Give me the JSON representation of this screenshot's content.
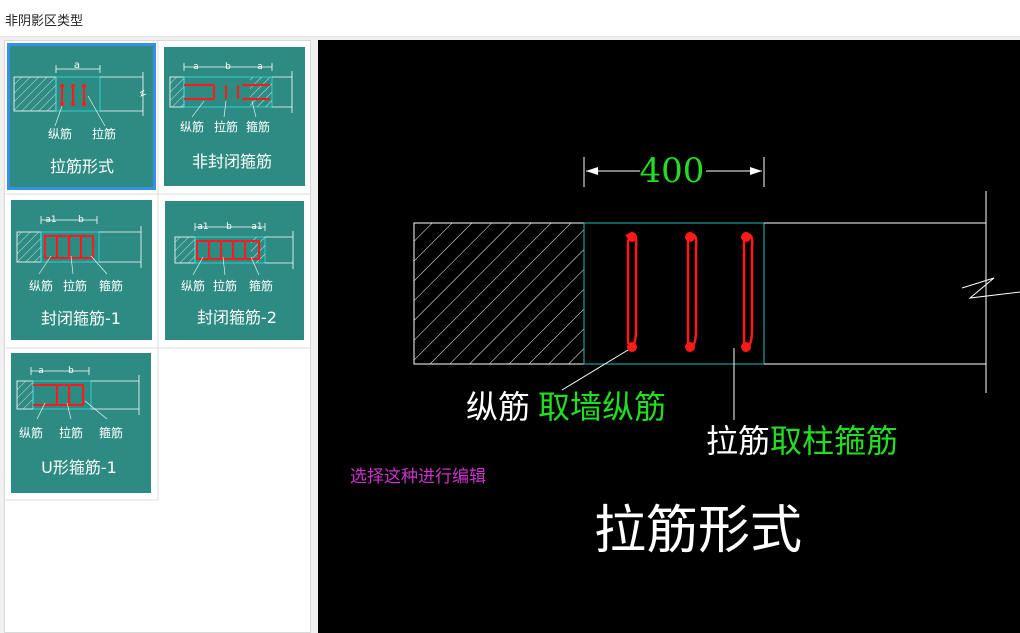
{
  "window": {
    "title": "非阴影区类型"
  },
  "thumbnails": [
    {
      "label": "拉筋形式",
      "selected": true,
      "legend": [
        "纵筋",
        "拉筋"
      ],
      "dims": [
        "a"
      ]
    },
    {
      "label": "非封闭箍筋",
      "selected": false,
      "legend": [
        "纵筋",
        "拉筋",
        "箍筋"
      ],
      "dims": [
        "a",
        "b",
        "a"
      ]
    },
    {
      "label": "封闭箍筋-1",
      "selected": false,
      "legend": [
        "纵筋",
        "拉筋",
        "箍筋"
      ],
      "dims": [
        "a1",
        "b"
      ]
    },
    {
      "label": "封闭箍筋-2",
      "selected": false,
      "legend": [
        "纵筋",
        "拉筋",
        "箍筋"
      ],
      "dims": [
        "a1",
        "b",
        "a1"
      ]
    },
    {
      "label": "U形箍筋-1",
      "selected": false,
      "legend": [
        "纵筋",
        "拉筋",
        "箍筋"
      ],
      "dims": [
        "a",
        "b"
      ]
    }
  ],
  "preview": {
    "dimension": "400",
    "label_longitudinal": "纵筋",
    "label_longitudinal_source": "取墙纵筋",
    "label_tie": "拉筋",
    "label_tie_source": "取柱箍筋",
    "hint": "选择这种进行编辑",
    "title": "拉筋形式"
  },
  "colors": {
    "thumb_bg": "#2e8b84",
    "rebar": "#ff1a1a",
    "green_text": "#22dd22",
    "hint": "#cc33cc",
    "outline": "#ffffff",
    "cyan": "#22bbbb",
    "selection": "#3a8ee6"
  }
}
